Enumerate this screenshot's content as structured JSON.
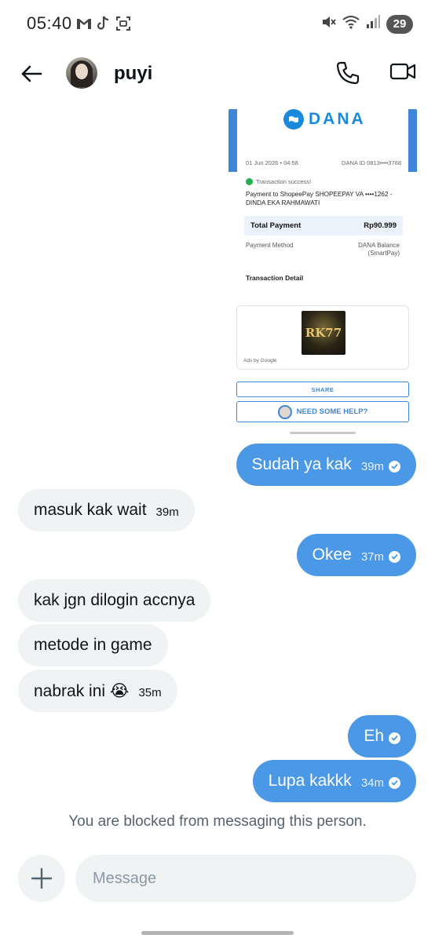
{
  "status_bar": {
    "time": "05:40",
    "battery": "29",
    "left_icons": [
      "gmail-icon",
      "tiktok-icon",
      "screenshot-icon"
    ],
    "right_icons": [
      "mute-icon",
      "wifi-icon",
      "signal-icon"
    ]
  },
  "header": {
    "contact_name": "puyi",
    "back_icon": "arrow-left-icon",
    "call_icon": "phone-icon",
    "video_icon": "video-camera-icon"
  },
  "shared_image": {
    "brand": "DANA",
    "date": "01 Jun 2026 • 04:58",
    "dana_id": "DANA ID 0813••••3768",
    "status": "Transaction success!",
    "title": "Payment to ShopeePay SHOPEEPAY VA ••••1262 - DINDA EKA RAHMAWATI",
    "total_label": "Total Payment",
    "total_value": "Rp90.999",
    "method_label": "Payment Method",
    "method_value_1": "DANA Balance",
    "method_value_2": "(SmartPay)",
    "detail_label": "Transaction Detail",
    "ad_logo_text": "RK77",
    "ad_label": "Ads by Google",
    "share_label": "SHARE",
    "help_label": "NEED SOME HELP?"
  },
  "messages": [
    {
      "direction": "out",
      "text": "Sudah ya kak",
      "time": "39m",
      "read": true
    },
    {
      "direction": "in",
      "text": "masuk kak wait",
      "time": "39m"
    },
    {
      "direction": "out",
      "text": "Okee",
      "time": "37m",
      "read": true
    },
    {
      "direction": "in",
      "text": "kak jgn dilogin accnya",
      "time": ""
    },
    {
      "direction": "in",
      "text": "metode in game",
      "time": ""
    },
    {
      "direction": "in",
      "text": "nabrak ini 😭",
      "time": "35m"
    },
    {
      "direction": "out",
      "text": "Eh",
      "time": "",
      "read": true
    },
    {
      "direction": "out",
      "text": "Lupa kakkk",
      "time": "34m",
      "read": true
    }
  ],
  "blocked_note": "You are blocked from messaging this person.",
  "composer": {
    "placeholder": "Message",
    "add_icon": "plus-icon"
  },
  "colors": {
    "outgoing_bubble": "#4a98e6",
    "incoming_bubble": "#eff3f4",
    "secondary_text": "#536471"
  }
}
